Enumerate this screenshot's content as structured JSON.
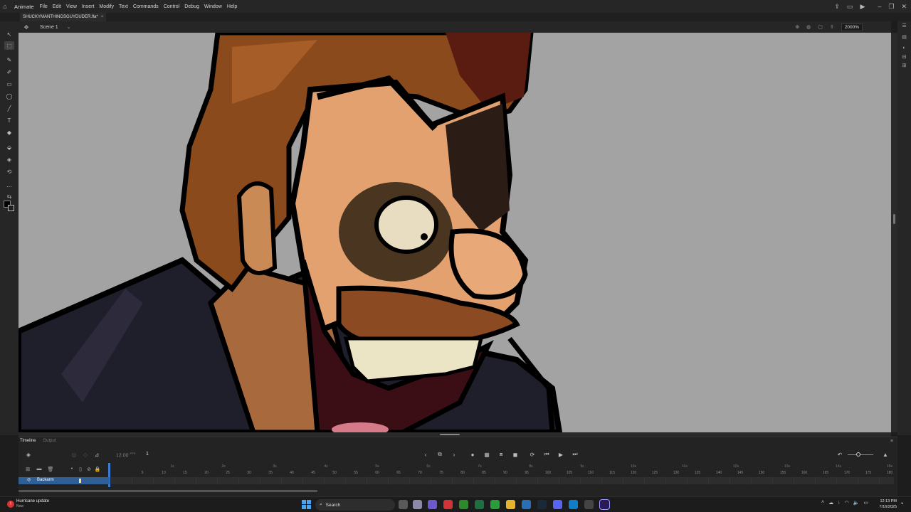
{
  "app": {
    "name": "Animate",
    "menu": [
      "File",
      "Edit",
      "View",
      "Insert",
      "Modify",
      "Text",
      "Commands",
      "Control",
      "Debug",
      "Window",
      "Help"
    ]
  },
  "document": {
    "tab_title": "SHUCKYMANTHINGSGUYDUDER.fla*",
    "tab_close": "×"
  },
  "scene": {
    "label": "Scene 1",
    "zoom": "2000%"
  },
  "timeline": {
    "tabs": [
      "Timeline",
      "Output"
    ],
    "fps": "12.00",
    "fps_unit": "FPS",
    "current_frame": "1",
    "layer": {
      "name": "Backarm"
    },
    "ruler_ticks": [
      "5",
      "10",
      "15",
      "20",
      "25",
      "30",
      "35",
      "40",
      "45",
      "50",
      "55",
      "60",
      "65",
      "70",
      "75",
      "80",
      "85",
      "90",
      "95",
      "100",
      "105",
      "110",
      "115",
      "120",
      "125",
      "130",
      "135",
      "140",
      "145",
      "150",
      "155",
      "160",
      "165",
      "170",
      "175",
      "180"
    ],
    "ruler_seconds": [
      "1s",
      "2s",
      "3s",
      "4s",
      "5s",
      "6s",
      "7s",
      "8s",
      "9s",
      "10s",
      "11s",
      "12s",
      "13s",
      "14s",
      "15s"
    ]
  },
  "taskbar": {
    "notification_title": "Hurricane update",
    "notification_sub": "Now",
    "search_label": "Search",
    "time": "12:13 PM",
    "date": "7/16/2025"
  },
  "colors": {
    "stage_bg": "#a3a3a3",
    "accent": "#3a7bd5",
    "layer_highlight": "#2f5f94"
  }
}
